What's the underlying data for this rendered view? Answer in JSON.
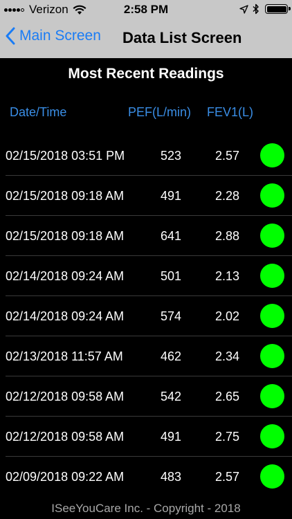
{
  "status_bar": {
    "carrier": "Verizon",
    "time": "2:58 PM"
  },
  "nav": {
    "back_label": "Main Screen",
    "title": "Data List Screen"
  },
  "section_title": "Most Recent Readings",
  "columns": {
    "date": "Date/Time",
    "pef": "PEF(L/min)",
    "fev1": "FEV1(L)"
  },
  "readings": [
    {
      "datetime": "02/15/2018 03:51 PM",
      "pef": "523",
      "fev1": "2.57",
      "status_color": "#00ff00"
    },
    {
      "datetime": "02/15/2018 09:18 AM",
      "pef": "491",
      "fev1": "2.28",
      "status_color": "#00ff00"
    },
    {
      "datetime": "02/15/2018 09:18 AM",
      "pef": "641",
      "fev1": "2.88",
      "status_color": "#00ff00"
    },
    {
      "datetime": "02/14/2018 09:24 AM",
      "pef": "501",
      "fev1": "2.13",
      "status_color": "#00ff00"
    },
    {
      "datetime": "02/14/2018 09:24 AM",
      "pef": "574",
      "fev1": "2.02",
      "status_color": "#00ff00"
    },
    {
      "datetime": "02/13/2018 11:57 AM",
      "pef": "462",
      "fev1": "2.34",
      "status_color": "#00ff00"
    },
    {
      "datetime": "02/12/2018 09:58 AM",
      "pef": "542",
      "fev1": "2.65",
      "status_color": "#00ff00"
    },
    {
      "datetime": "02/12/2018 09:58 AM",
      "pef": "491",
      "fev1": "2.75",
      "status_color": "#00ff00"
    },
    {
      "datetime": "02/09/2018 09:22 AM",
      "pef": "483",
      "fev1": "2.57",
      "status_color": "#00ff00"
    }
  ],
  "footer": "ISeeYouCare Inc. - Copyright - 2018",
  "colors": {
    "accent": "#1a7cf5",
    "header_text": "#3a8ee6",
    "status_ok": "#00ff00",
    "bar_background": "#c8c8c8"
  }
}
